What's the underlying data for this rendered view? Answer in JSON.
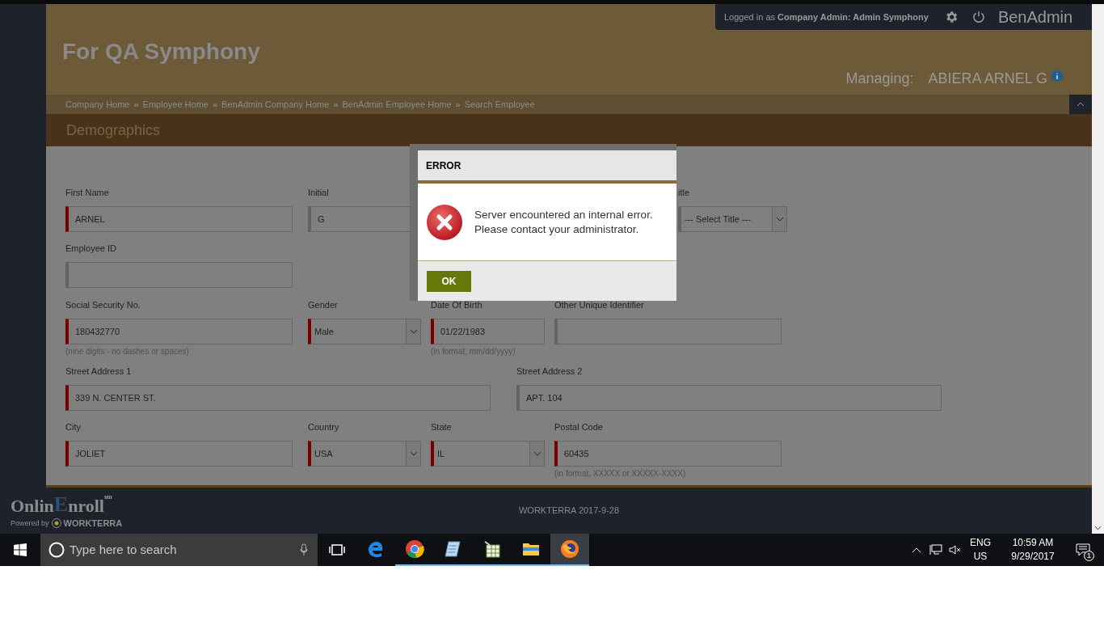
{
  "top_bar": {
    "logged_in": "Logged in as **Company Admin:  Admin Symphony**",
    "app_name": "BenAdmin"
  },
  "header": {
    "title": "For QA Symphony",
    "managing_label": "Managing:",
    "managing_name": "ABIERA ARNEL G"
  },
  "breadcrumbs": {
    "separator": "»",
    "items": [
      "Company Home",
      "Employee Home",
      "BenAdmin Company Home",
      "BenAdmin Employee Home",
      "Search Employee"
    ]
  },
  "section_title": "Demographics",
  "form_rows": [
    {
      "fields": [
        {
          "label": "First Name",
          "value": "ARNEL",
          "kind": "text",
          "required": true
        },
        {
          "label": "Initial",
          "value": "G",
          "kind": "text",
          "required": false
        },
        {
          "label": "itle",
          "value": "--- Select Title ---",
          "kind": "select",
          "required": false
        }
      ]
    },
    {
      "fields": [
        {
          "label": "Employee ID",
          "kind": "text",
          "required": false
        }
      ]
    },
    {
      "fields": [
        {
          "label": "Social Security No.",
          "value": "180432770",
          "kind": "text",
          "required": true,
          "hint": "(nine digits - no dashes or spaces)"
        },
        {
          "label": "Gender",
          "value": "Male",
          "kind": "select",
          "required": true
        },
        {
          "label": "Date Of Birth",
          "value": "01/22/1983",
          "kind": "text",
          "required": true,
          "hint": "(in format, mm/dd/yyyy)"
        },
        {
          "label": "Other Unique Identifier",
          "kind": "text",
          "required": false
        }
      ]
    },
    {
      "fields": [
        {
          "label": "Street Address 1",
          "value": "339 N. CENTER ST.",
          "kind": "text",
          "required": true
        },
        {
          "label": "Street Address 2",
          "value": "APT. 104",
          "kind": "text",
          "required": false
        }
      ]
    },
    {
      "fields": [
        {
          "label": "City",
          "value": "JOLIET",
          "kind": "text",
          "required": true
        },
        {
          "label": "Country",
          "value": "USA",
          "kind": "select",
          "required": true
        },
        {
          "label": "State",
          "value": "IL",
          "kind": "select",
          "required": true
        },
        {
          "label": "Postal Code",
          "value": "60435",
          "kind": "text",
          "required": true,
          "hint": "(in format, XXXXX or XXXXX-XXXX)"
        }
      ]
    }
  ],
  "dialog": {
    "title": "ERROR",
    "lines": [
      "Server encountered an internal error.",
      "Please contact your administrator."
    ],
    "button": "OK"
  },
  "footer": {
    "logo": {
      "before": "Onlin",
      "initial": "E",
      "after": "nroll",
      "mark": "sm",
      "powered_by": "Powered by",
      "brand": "WORKTERRA"
    },
    "center": "WORKTERRA 2017-9-28"
  },
  "taskbar": {
    "search_placeholder": "Type here to search",
    "apps": [
      {
        "kind": "edge",
        "running": false,
        "active": false
      },
      {
        "kind": "chrome",
        "running": true,
        "active": false
      },
      {
        "kind": "notepad",
        "running": true,
        "active": false
      },
      {
        "kind": "sheet",
        "running": true,
        "active": false
      },
      {
        "kind": "folder",
        "running": true,
        "active": false
      },
      {
        "kind": "firefox",
        "running": true,
        "active": true
      }
    ],
    "language": "ENG",
    "region": "US",
    "time": "10:59 AM",
    "date": "9/29/2017",
    "notifications": "1"
  }
}
